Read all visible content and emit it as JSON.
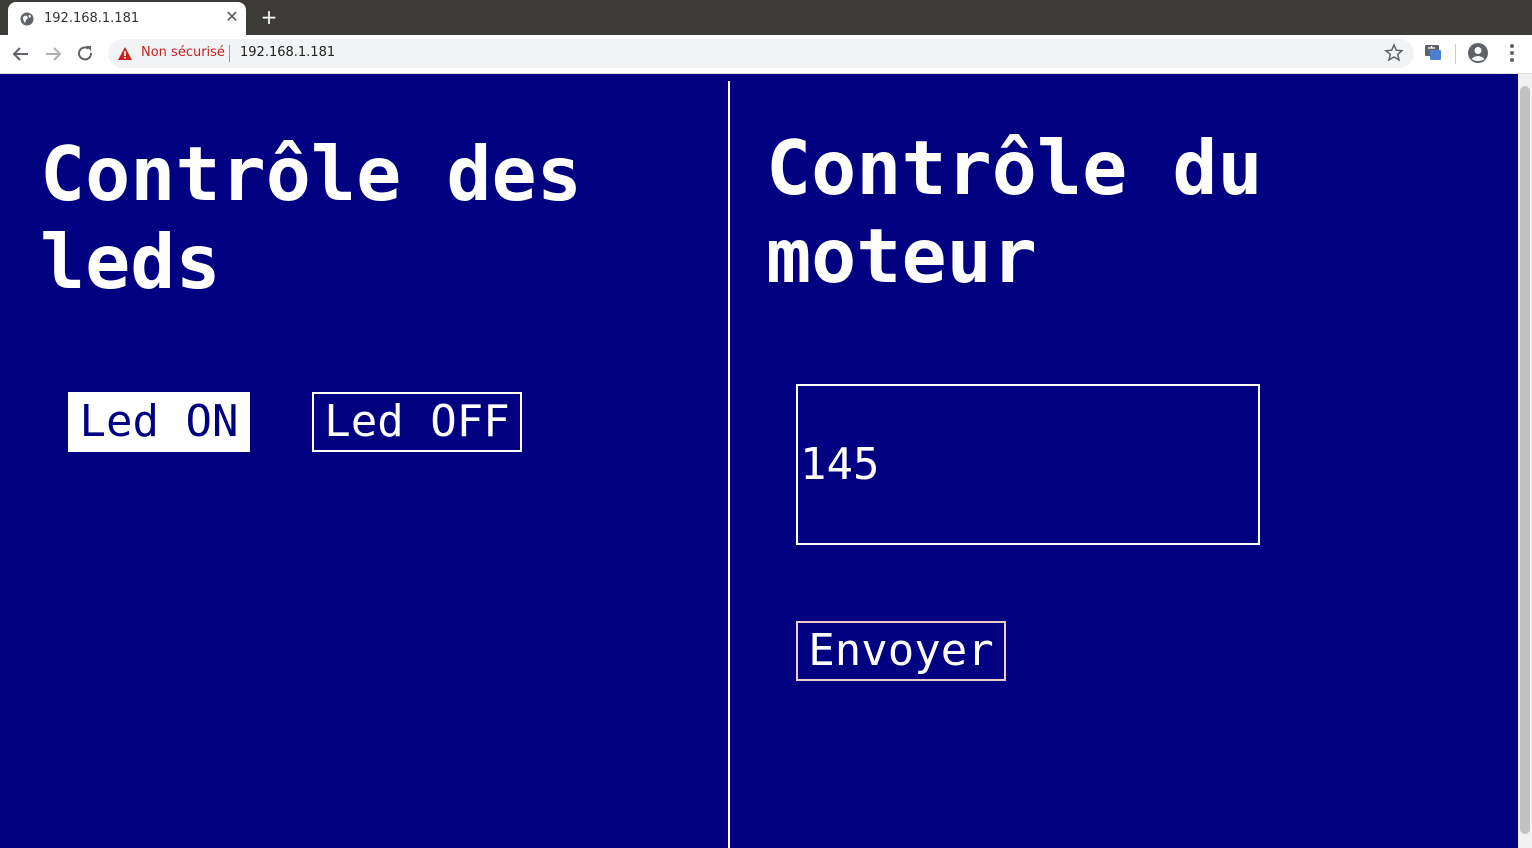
{
  "browser": {
    "tab": {
      "title": "192.168.1.181",
      "close_glyph": "✕"
    },
    "new_tab_glyph": "+",
    "address": {
      "security_label": "Non sécurisé",
      "url": "192.168.1.181"
    }
  },
  "page": {
    "leds": {
      "heading": "Contrôle des leds",
      "on_label": "Led ON",
      "off_label": "Led OFF"
    },
    "motor": {
      "heading": "Contrôle du moteur",
      "value": "145",
      "send_label": "Envoyer"
    }
  },
  "colors": {
    "page_background": "#000080",
    "foreground": "#ffffff",
    "warning": "#c5221f"
  }
}
